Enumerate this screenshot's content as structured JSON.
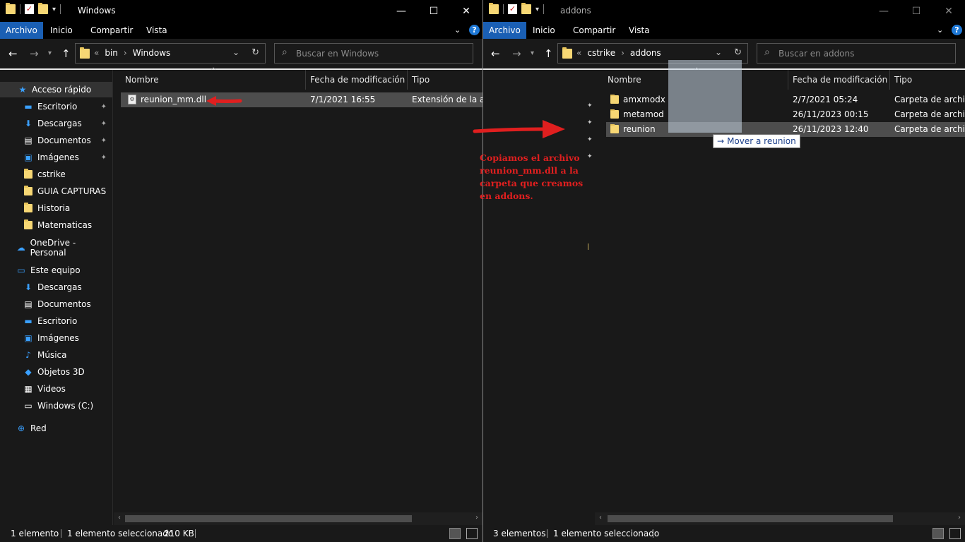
{
  "left_window": {
    "title": "Windows",
    "ribbon": {
      "tabs": [
        "Archivo",
        "Inicio",
        "Compartir",
        "Vista"
      ]
    },
    "address": {
      "prefix": "«",
      "crumbs": [
        "bin",
        "Windows"
      ]
    },
    "search_placeholder": "Buscar en Windows",
    "nav": [
      {
        "label": "Acceso rápido",
        "icon": "star-icon",
        "selected": true
      },
      {
        "label": "Escritorio",
        "icon": "desktop-icon",
        "pinned": true
      },
      {
        "label": "Descargas",
        "icon": "download-icon",
        "pinned": true
      },
      {
        "label": "Documentos",
        "icon": "document-icon",
        "pinned": true
      },
      {
        "label": "Imágenes",
        "icon": "pictures-icon",
        "pinned": true
      },
      {
        "label": "cstrike",
        "icon": "folder-icon"
      },
      {
        "label": "GUIA CAPTURAS",
        "icon": "folder-icon"
      },
      {
        "label": "Historia",
        "icon": "folder-icon"
      },
      {
        "label": "Matematicas",
        "icon": "folder-icon"
      },
      {
        "label": "OneDrive - Personal",
        "icon": "cloud-icon"
      },
      {
        "label": "Este equipo",
        "icon": "computer-icon"
      },
      {
        "label": "Descargas",
        "icon": "download-icon"
      },
      {
        "label": "Documentos",
        "icon": "document-icon"
      },
      {
        "label": "Escritorio",
        "icon": "desktop-icon"
      },
      {
        "label": "Imágenes",
        "icon": "pictures-icon"
      },
      {
        "label": "Música",
        "icon": "music-icon"
      },
      {
        "label": "Objetos 3D",
        "icon": "cube-icon"
      },
      {
        "label": "Videos",
        "icon": "video-icon"
      },
      {
        "label": "Windows (C:)",
        "icon": "drive-icon"
      },
      {
        "label": "Red",
        "icon": "network-icon"
      }
    ],
    "columns": [
      "Nombre",
      "Fecha de modificación",
      "Tipo"
    ],
    "rows": [
      {
        "name": "reunion_mm.dll",
        "date": "7/1/2021 16:55",
        "type": "Extensión de la ap...",
        "selected": true
      }
    ],
    "status": {
      "count": "1 elemento",
      "selected": "1 elemento seleccionado",
      "size": "210 KB"
    }
  },
  "right_window": {
    "title": "addons",
    "ribbon": {
      "tabs": [
        "Archivo",
        "Inicio",
        "Compartir",
        "Vista"
      ]
    },
    "address": {
      "prefix": "«",
      "crumbs": [
        "cstrike",
        "addons"
      ]
    },
    "search_placeholder": "Buscar en addons",
    "columns": [
      "Nombre",
      "Fecha de modificación",
      "Tipo"
    ],
    "rows": [
      {
        "name": "amxmodx",
        "date": "2/7/2021 05:24",
        "type": "Carpeta de archivos"
      },
      {
        "name": "metamod",
        "date": "26/11/2023 00:15",
        "type": "Carpeta de archivos"
      },
      {
        "name": "reunion",
        "date": "26/11/2023 12:40",
        "type": "Carpeta de archivos",
        "selected": true
      }
    ],
    "drag_tooltip": "Mover a reunion",
    "status": {
      "count": "3 elementos",
      "selected": "1 elemento seleccionado"
    }
  },
  "annotation": "Copiamos el archivo reunion_mm.dll a la carpeta que creamos en addons.",
  "colors": {
    "accent": "#1a5fb4",
    "annotation": "#e01f1f",
    "folder": "#f7d774"
  }
}
